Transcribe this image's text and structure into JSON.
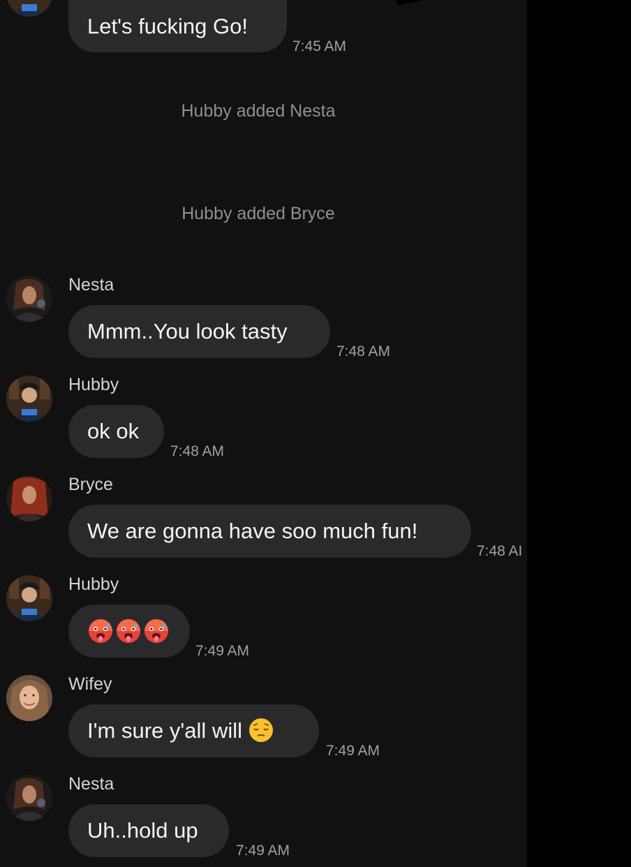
{
  "messages_top": {
    "first_text": "Let's fucking Go!",
    "first_time": "7:45 AM"
  },
  "system": {
    "added_nesta": "Hubby added Nesta",
    "added_bryce": "Hubby added Bryce"
  },
  "messages": [
    {
      "sender": "Nesta",
      "text": "Mmm..You look tasty",
      "time": "7:48 AM"
    },
    {
      "sender": "Hubby",
      "text": "ok ok",
      "time": "7:48 AM"
    },
    {
      "sender": "Bryce",
      "text": "We are gonna have soo much fun!",
      "time": "7:48 AI"
    },
    {
      "sender": "Hubby",
      "emoji": [
        "hot-face-emoji",
        "hot-face-emoji",
        "hot-face-emoji"
      ],
      "time": "7:49 AM"
    },
    {
      "sender": "Wifey",
      "text": "I'm sure y'all  will",
      "emoji": "pensive-face-emoji",
      "time": "7:49 AM"
    },
    {
      "sender": "Nesta",
      "text": "Uh..hold up",
      "time": "7:49 AM"
    }
  ],
  "colors": {
    "background": "#111112",
    "bubble": "#2a2a2c",
    "text": "#f4f4f5",
    "meta": "#a1a1aa"
  }
}
